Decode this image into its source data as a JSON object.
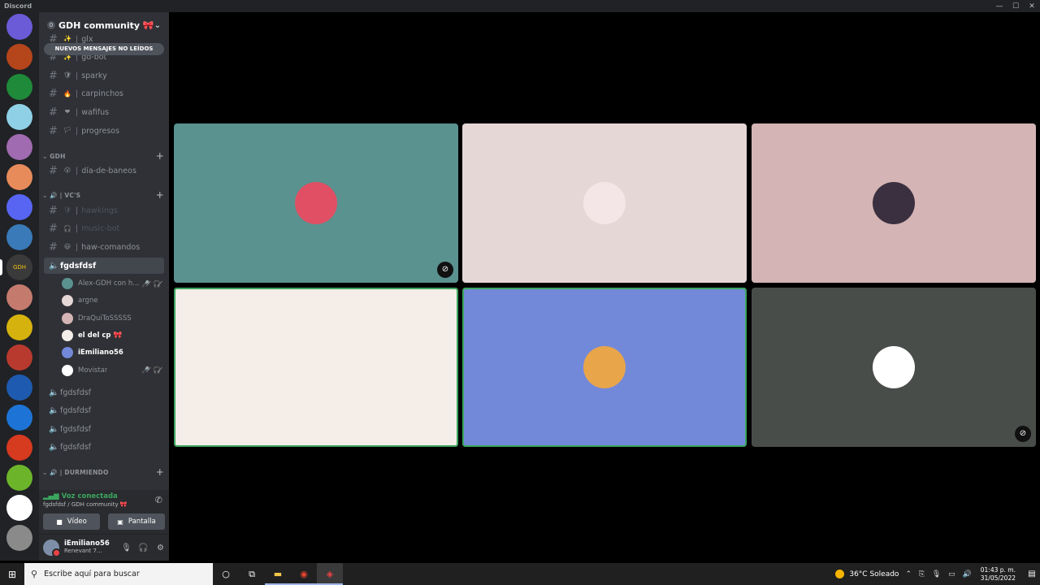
{
  "window": {
    "title": "Discord",
    "controls": [
      "—",
      "☐",
      "✕"
    ]
  },
  "guilds": [
    {
      "color": "#6b5bd6"
    },
    {
      "color": "#b5451b"
    },
    {
      "color": "#1f8a3a"
    },
    {
      "color": "#8fd0e6"
    },
    {
      "color": "#a06bb0"
    },
    {
      "color": "#e88b5b"
    },
    {
      "color": "#5865f2"
    },
    {
      "color": "#3a7ab8"
    },
    {
      "color": "#3a3a3a",
      "label": "GDH"
    },
    {
      "color": "#c47b6e"
    },
    {
      "color": "#d6b20f"
    },
    {
      "color": "#b83a2f"
    },
    {
      "color": "#1e5bb0"
    },
    {
      "color": "#1d74d6"
    },
    {
      "color": "#d63a1f"
    },
    {
      "color": "#6cb52a"
    },
    {
      "color": "#ffffff"
    },
    {
      "color": "#8a8a8a"
    }
  ],
  "server": {
    "name": "GDH community 🎀",
    "boost_count": "0"
  },
  "unread_banner": "NUEVOS MENSAJES NO LEÍDOS",
  "channels_top": [
    {
      "name": "glx",
      "emoji": "✨",
      "muted": false
    },
    {
      "name": "gd-bot",
      "emoji": "✨",
      "muted": false
    },
    {
      "name": "sparky",
      "emoji": "🛡",
      "muted": false
    },
    {
      "name": "carpinchos",
      "emoji": "🔥",
      "muted": false
    },
    {
      "name": "wafifus",
      "emoji": "❤",
      "muted": false
    },
    {
      "name": "progresos",
      "emoji": "🏳",
      "muted": false
    }
  ],
  "category_gdh": "GDH",
  "channel_baneos": {
    "name": "día-de-baneos",
    "emoji": "😮"
  },
  "category_vcs": "VC'S",
  "vc_text_channels": [
    {
      "name": "hawkings",
      "emoji": "🛡",
      "muted": true
    },
    {
      "name": "music-bot",
      "emoji": "🎧",
      "muted": true
    },
    {
      "name": "haw-comandos",
      "emoji": "😃",
      "muted": false
    }
  ],
  "active_voice_channel": "fgdsfdsf",
  "voice_users": [
    {
      "name": "Alex-GDH con h...",
      "color": "#5a9290",
      "icons": "🎤̸🎧̸",
      "bold": false
    },
    {
      "name": "argne",
      "color": "#e6d7d7",
      "icons": "",
      "bold": false
    },
    {
      "name": "DraQuiToSSSSS",
      "color": "#d4b4b4",
      "icons": "",
      "bold": false
    },
    {
      "name": "el del cp 🎀",
      "color": "#f5ede8",
      "icons": "",
      "bold": true
    },
    {
      "name": "iEmiliano56",
      "color": "#7289da",
      "icons": "",
      "bold": true
    },
    {
      "name": "Movistar",
      "color": "#ffffff",
      "icons": "🎤̸🎧̸",
      "bold": false
    }
  ],
  "other_voice_channels": [
    "fgdsfdsf",
    "fgdsfdsf",
    "fgdsfdsf",
    "fgdsfdsf"
  ],
  "category_durmiendo": "DURMIENDO",
  "voice_panel": {
    "status": "Voz conectada",
    "location": "fgdsfdsf / GDH community 🎀",
    "video_label": "Vídeo",
    "screen_label": "Pantalla"
  },
  "user": {
    "name": "iEmiliano56",
    "status": "Renevant 7..."
  },
  "tiles": [
    {
      "bg": "#5a9290",
      "avatar": "#e04f63",
      "muted": true,
      "speaking": false
    },
    {
      "bg": "#e6d7d7",
      "avatar": "#f4e6e6",
      "muted": false,
      "speaking": false
    },
    {
      "bg": "#d4b4b4",
      "avatar": "#3a3040",
      "muted": false,
      "speaking": false
    },
    {
      "bg": "#f5ede8",
      "avatar": "#f5ede8",
      "muted": false,
      "speaking": true
    },
    {
      "bg": "#7289da",
      "avatar": "#e8a54a",
      "muted": false,
      "speaking": true
    },
    {
      "bg": "#494d4a",
      "avatar": "#ffffff",
      "muted": true,
      "speaking": false
    }
  ],
  "taskbar": {
    "search_placeholder": "Escribe aquí para buscar",
    "weather": "36°C Soleado",
    "time": "01:43 p. m.",
    "date": "31/05/2022"
  }
}
